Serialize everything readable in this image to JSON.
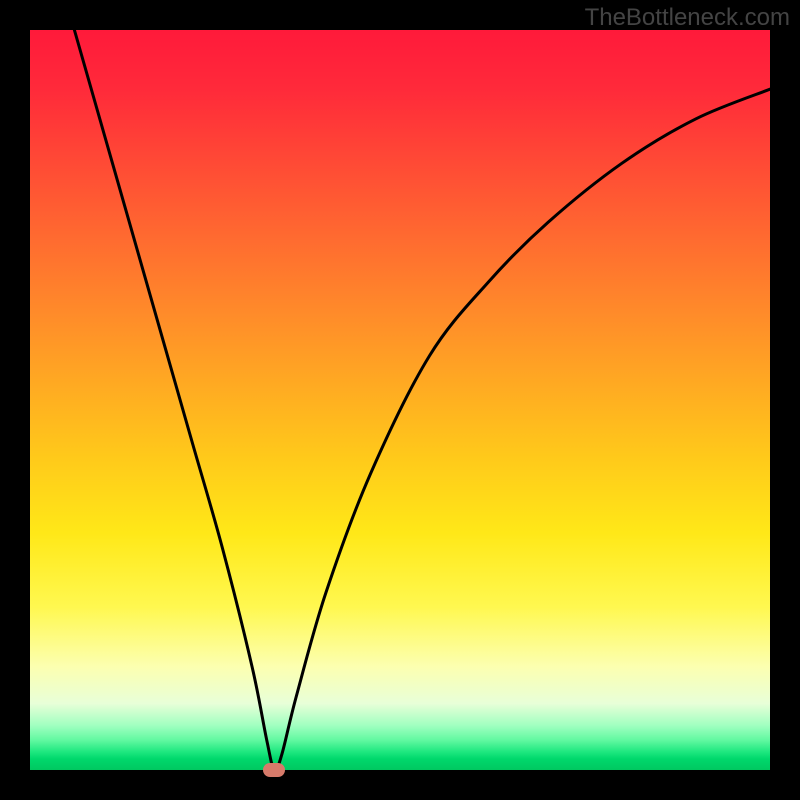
{
  "watermark": "TheBottleneck.com",
  "chart_data": {
    "type": "line",
    "title": "",
    "xlabel": "",
    "ylabel": "",
    "xlim": [
      0,
      100
    ],
    "ylim": [
      0,
      100
    ],
    "background_gradient": {
      "top": "#ff1a3a",
      "middle": "#ffe818",
      "bottom": "#00c860"
    },
    "curve": {
      "description": "V-shaped bottleneck curve",
      "x": [
        6,
        10,
        14,
        18,
        22,
        26,
        30,
        32,
        33,
        34,
        36,
        40,
        46,
        54,
        62,
        70,
        80,
        90,
        100
      ],
      "y": [
        100,
        86,
        72,
        58,
        44,
        30,
        14,
        4,
        0,
        2,
        10,
        24,
        40,
        56,
        66,
        74,
        82,
        88,
        92
      ]
    },
    "marker": {
      "x": 33,
      "y": 0,
      "color": "#d67a6a",
      "shape": "rounded-rect"
    },
    "annotations": []
  }
}
